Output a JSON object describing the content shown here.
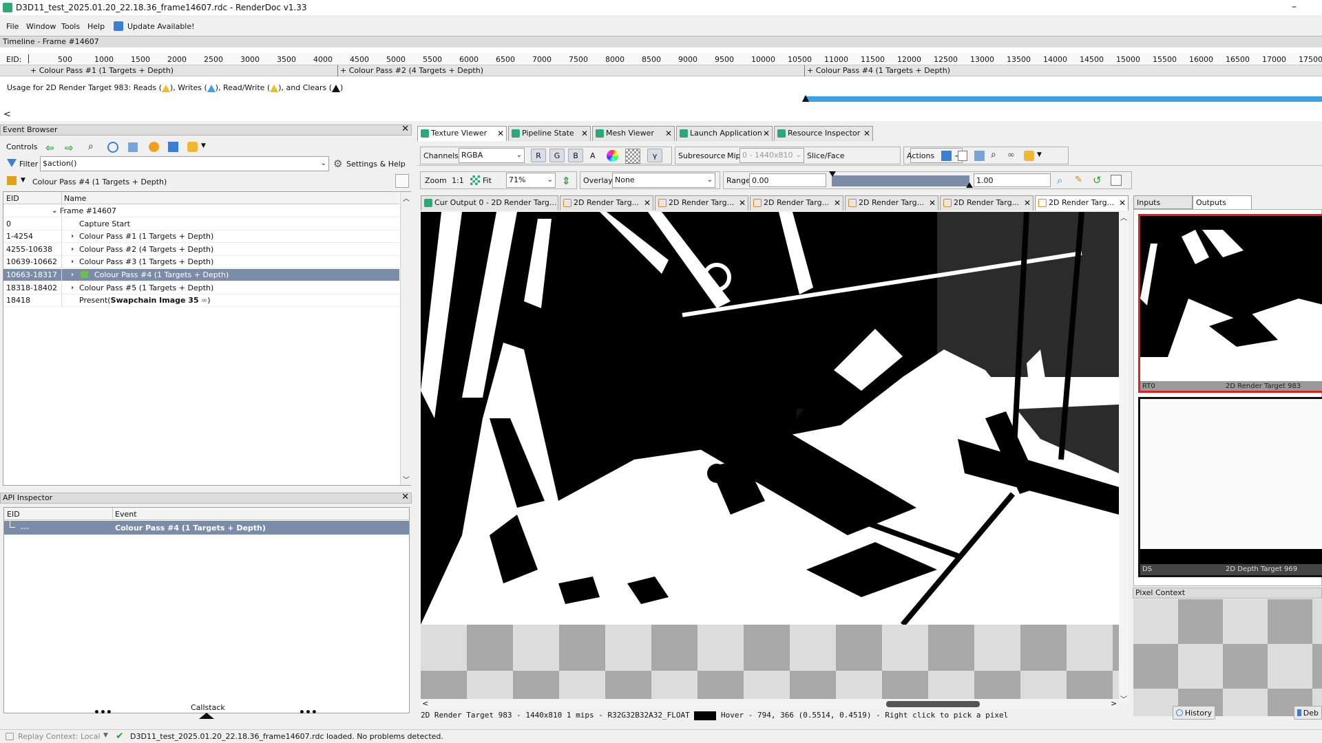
{
  "app": {
    "title": "D3D11_test_2025.01.20_22.18.36_frame14607.rdc - RenderDoc v1.33"
  },
  "menu": {
    "items": [
      "File",
      "Window",
      "Tools",
      "Help"
    ],
    "update": "Update Available!"
  },
  "timeline": {
    "title": "Timeline - Frame #14607",
    "eid_label": "EID:",
    "ticks": [
      "500",
      "1000",
      "1500",
      "2000",
      "2500",
      "3000",
      "3500",
      "4000",
      "4500",
      "5000",
      "5500",
      "6000",
      "6500",
      "7000",
      "7500",
      "8000",
      "8500",
      "9000",
      "9500",
      "10000",
      "10500",
      "11000",
      "11500",
      "12000",
      "12500",
      "13000",
      "13500",
      "14000",
      "14500",
      "15000",
      "15500",
      "16000",
      "16500",
      "17000",
      "17500"
    ],
    "passes": [
      "+ Colour Pass #1 (1 Targets + Depth)",
      "+ Colour Pass #2 (4 Targets + Depth)",
      "+ Colour Pass #4 (1 Targets + Depth)"
    ],
    "usage_prefix": "Usage for 2D Render Target 983: Reads (",
    "usage_writes": "), Writes (",
    "usage_rw": "), Read/Write (",
    "usage_clears": "), and Clears (",
    "usage_end": ")",
    "back_arrow": "<"
  },
  "event_browser": {
    "title": "Event Browser",
    "controls_label": "Controls",
    "filter_label": "Filter",
    "filter_value": "$action()",
    "settings_label": "Settings & Help",
    "breadcrumb": "Colour Pass #4 (1 Targets + Depth)",
    "columns": [
      "EID",
      "Name"
    ],
    "rows": [
      {
        "eid": "",
        "name": "Frame #14607",
        "indent": 0,
        "expander": "v"
      },
      {
        "eid": "0",
        "name": "Capture Start",
        "indent": 1,
        "expander": ""
      },
      {
        "eid": "1-4254",
        "name": "Colour Pass #1 (1 Targets + Depth)",
        "indent": 1,
        "expander": ">"
      },
      {
        "eid": "4255-10638",
        "name": "Colour Pass #2 (4 Targets + Depth)",
        "indent": 1,
        "expander": ">"
      },
      {
        "eid": "10639-10662",
        "name": "Colour Pass #3 (1 Targets + Depth)",
        "indent": 1,
        "expander": ">"
      },
      {
        "eid": "10663-18317",
        "name": "Colour Pass #4 (1 Targets + Depth)",
        "indent": 1,
        "expander": ">",
        "selected": true
      },
      {
        "eid": "18318-18402",
        "name": "Colour Pass #5 (1 Targets + Depth)",
        "indent": 1,
        "expander": ">"
      },
      {
        "eid": "18418",
        "name_prefix": "Present(",
        "name_bold": "Swapchain Image 35",
        "name_suffix": ")",
        "indent": 1,
        "expander": ""
      }
    ]
  },
  "api_inspector": {
    "title": "API Inspector",
    "columns": [
      "EID",
      "Event"
    ],
    "row_eid": "---",
    "row_event": "Colour Pass #4 (1 Targets + Depth)",
    "footer_left": "•••",
    "footer_center": "Callstack",
    "footer_right": "•••"
  },
  "main_tabs": [
    {
      "label": "Texture Viewer",
      "active": true
    },
    {
      "label": "Pipeline State"
    },
    {
      "label": "Mesh Viewer"
    },
    {
      "label": "Launch Application"
    },
    {
      "label": "Resource Inspector"
    }
  ],
  "toolbar1": {
    "channels_label": "Channels",
    "channels_value": "RGBA",
    "r": "R",
    "g": "G",
    "b": "B",
    "a": "A",
    "gamma": "γ",
    "subresource_label": "Subresource",
    "mip_label": "Mip",
    "mip_value": "0 - 1440x810",
    "slice_label": "Slice/Face",
    "slice_value": "",
    "actions_label": "Actions"
  },
  "toolbar2": {
    "zoom_label": "Zoom",
    "zoom_1to1": "1:1",
    "fit_label": "Fit",
    "zoom_value": "71%",
    "overlay_label": "Overlay",
    "overlay_value": "None",
    "range_label": "Range",
    "range_min": "0.00",
    "range_max": "1.00"
  },
  "texture_tabs": [
    {
      "label": "Cur Output 0 - 2D Render Targ...",
      "active": false
    },
    {
      "label": "2D Render Targ..."
    },
    {
      "label": "2D Render Targ..."
    },
    {
      "label": "2D Render Targ..."
    },
    {
      "label": "2D Render Targ..."
    },
    {
      "label": "2D Render Targ..."
    },
    {
      "label": "2D Render Targ...",
      "active": true
    }
  ],
  "status_line": {
    "info": "2D Render Target 983 - 1440x810 1 mips - R32G32B32A32_FLOAT",
    "hover": "Hover -   794,  366 (0.5514, 0.4519) - Right click to pick a pixel"
  },
  "right_panel": {
    "tabs": [
      "Inputs",
      "Outputs"
    ],
    "thumb1_left": "RT0",
    "thumb1_right": "2D Render Target 983",
    "thumb2_left": "DS",
    "thumb2_right": "2D Depth Target 969",
    "pixel_context_title": "Pixel Context",
    "history_label": "History",
    "debug_label": "Deb"
  },
  "statusbar": {
    "replay_context": "Replay Context: Local",
    "message": "D3D11_test_2025.01.20_22.18.36_frame14607.rdc loaded. No problems detected."
  },
  "colors": {
    "accent": "#2ea878",
    "selection": "#7a8ca8",
    "timeline_bar": "#3ea0e0",
    "red_border": "#e02020"
  }
}
